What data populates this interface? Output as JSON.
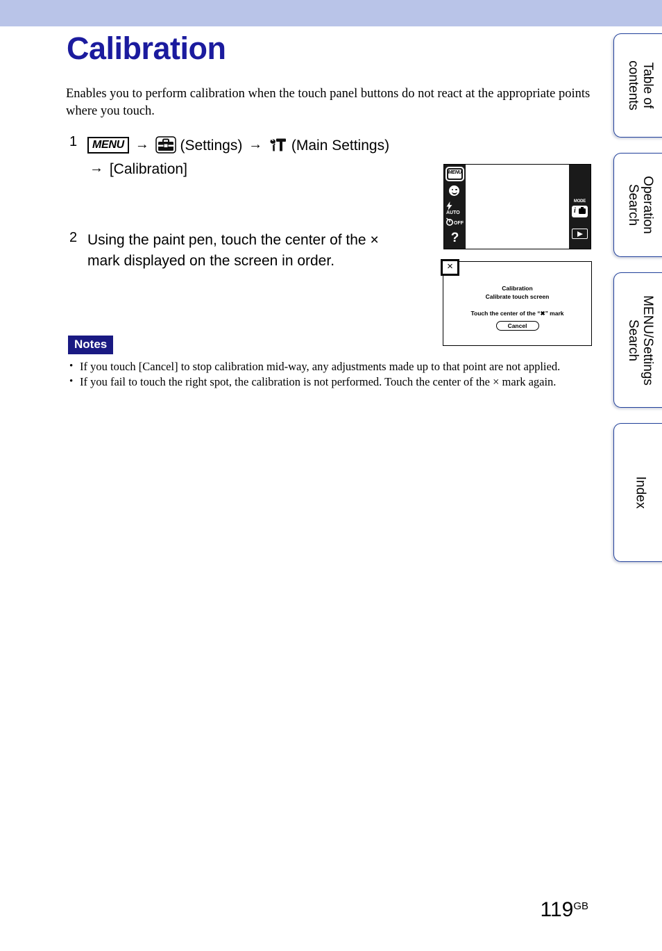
{
  "header": {
    "band_color": "#b9c4e8"
  },
  "page": {
    "title": "Calibration",
    "title_color": "#1b1b9e",
    "intro": "Enables you to perform calibration when the touch panel buttons do not react at the appropriate points where you touch.",
    "page_number": "119",
    "page_number_suffix": "GB"
  },
  "steps": [
    {
      "number": "1",
      "menu_chip": "MENU",
      "arrow": "→",
      "settings_label": "(Settings)",
      "main_settings_label": "(Main Settings)",
      "line2": "[Calibration]"
    },
    {
      "number": "2",
      "text_line1": "Using the paint pen, touch the center of the ×",
      "text_line2": "mark displayed on the screen in order."
    }
  ],
  "lcd_screen": {
    "menu_button": "MENU",
    "flash_label": "AUTO",
    "timer_label": "OFF",
    "help_glyph": "?",
    "mode_label": "MODE",
    "mode_i": "i"
  },
  "calibration_dialog": {
    "close_glyph": "×",
    "title": "Calibration",
    "subtitle": "Calibrate touch screen",
    "instruction": "Touch the center of the “✖” mark",
    "cancel_button": "Cancel"
  },
  "notes": {
    "label": "Notes",
    "label_bg": "#191982",
    "items": [
      "If you touch [Cancel] to stop calibration mid-way, any adjustments made up to that point are not applied.",
      "If you fail to touch the right spot, the calibration is not performed. Touch the center of the × mark again."
    ]
  },
  "side_tabs": [
    {
      "line1": "Table of",
      "line2": "contents"
    },
    {
      "line1": "Operation",
      "line2": "Search"
    },
    {
      "line1": "MENU/Settings",
      "line2": "Search"
    },
    {
      "line1": "Index",
      "line2": ""
    }
  ]
}
